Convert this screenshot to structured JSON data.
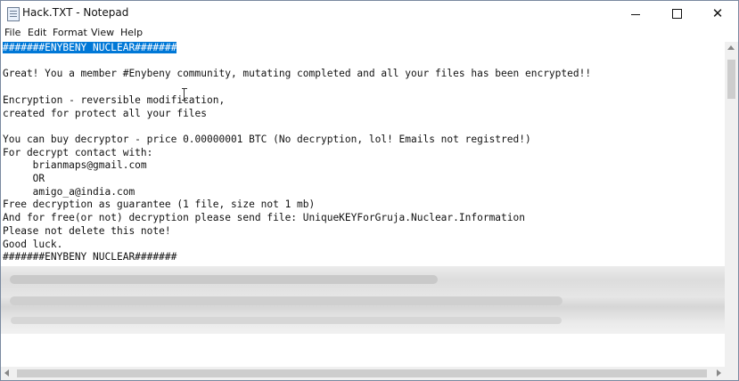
{
  "window": {
    "title": "Hack.TXT - Notepad",
    "controls": {
      "minimize": "minimize-icon",
      "maximize": "maximize-icon",
      "close": "close-icon",
      "close_glyph": "✕"
    }
  },
  "menu": [
    "File",
    "Edit",
    "Format",
    "View",
    "Help"
  ],
  "document": {
    "selected_line": "#######ENYBENY NUCLEAR#######",
    "lines": [
      "",
      "Great! You a member #Enybeny community, mutating completed and all your files has been encrypted!!",
      "",
      "Encryption - reversible modification,",
      "created for protect all your files",
      "",
      "You can buy decryptor - price 0.00000001 BTC (No decryption, lol! Emails not registred!)",
      "For decrypt contact with:",
      "     brianmaps@gmail.com",
      "     OR",
      "     amigo_a@india.com",
      "Free decryption as guarantee (1 file, size not 1 mb)",
      "And for free(or not) decryption please send file: UniqueKEYForGruja.Nuclear.Information",
      "Please not delete this note!",
      "Good luck.",
      "#######ENYBENY NUCLEAR#######"
    ]
  },
  "icons": {
    "app": "notepad-icon",
    "text_cursor": "text-cursor-icon"
  },
  "colors": {
    "selection": "#0078d7",
    "selection_text": "#ffffff"
  }
}
